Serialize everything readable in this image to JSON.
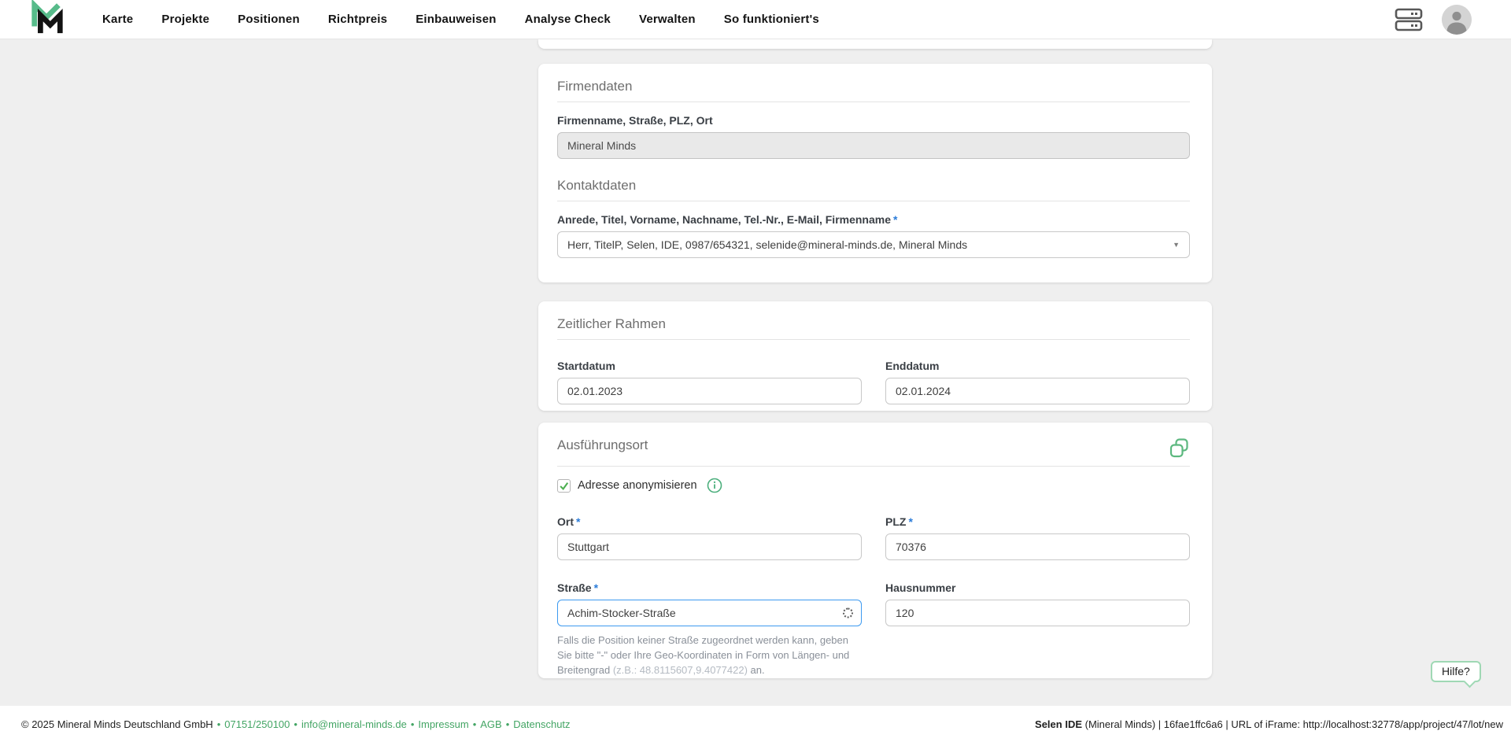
{
  "nav": {
    "items": [
      "Karte",
      "Projekte",
      "Positionen",
      "Richtpreis",
      "Einbauweisen",
      "Analyse Check",
      "Verwalten",
      "So funktioniert's"
    ]
  },
  "icons": {
    "logo": "mineral-minds-logo",
    "sessions": "server-icon",
    "account": "user-avatar-icon",
    "copy": "copy-icon",
    "info": "info-icon",
    "check": "checkmark-icon",
    "caret": "dropdown-caret-icon",
    "spinner": "loading-spinner-icon"
  },
  "labels": {
    "required_marker": "*"
  },
  "company_card": {
    "title": "Firmendaten",
    "company_label": "Firmenname, Straße, PLZ, Ort",
    "company_value": "Mineral Minds",
    "contact_title": "Kontaktdaten",
    "contact_label": "Anrede, Titel, Vorname, Nachname, Tel.-Nr., E-Mail, Firmenname",
    "contact_value": "Herr, TitelP, Selen, IDE, 0987/654321, selenide@mineral-minds.de, Mineral Minds",
    "caret_glyph": "▼"
  },
  "timeframe_card": {
    "title": "Zeitlicher Rahmen",
    "start_label": "Startdatum",
    "start_value": "02.01.2023",
    "end_label": "Enddatum",
    "end_value": "02.01.2024"
  },
  "location_card": {
    "title": "Ausführungsort",
    "anonymize_label": "Adresse anonymisieren",
    "city_label": "Ort",
    "city_value": "Stuttgart",
    "zip_label": "PLZ",
    "zip_value": "70376",
    "street_label": "Straße",
    "street_value": "Achim-Stocker-Straße",
    "number_label": "Hausnummer",
    "number_value": "120",
    "hint_main": "Falls die Position keiner Straße zugeordnet werden kann, geben Sie bitte \"-\" oder Ihre Geo-Koordinaten in Form von Längen- und Breitengrad",
    "hint_example": "(z.B.: 48.8115607,9.4077422)",
    "hint_suffix": "an."
  },
  "help_button": {
    "label": "Hilfe?"
  },
  "footer": {
    "copyright": "© 2025 Mineral Minds Deutschland GmbH",
    "separator": "•",
    "links": [
      "07151/250100",
      "info@mineral-minds.de",
      "Impressum",
      "AGB",
      "Datenschutz"
    ],
    "right_bold": "Selen IDE",
    "right_rest": "(Mineral Minds) | 16fae1ffc6a6 | URL of iFrame: http://localhost:32778/app/project/47/lot/new"
  },
  "colors": {
    "brand_green": "#52b788",
    "icon_green": "#4caf7d",
    "link_green": "#43a564",
    "check_green": "#4caf50",
    "required_blue": "#2b7cd9",
    "focus_blue": "#3d9af0",
    "page_background": "#efefef"
  }
}
